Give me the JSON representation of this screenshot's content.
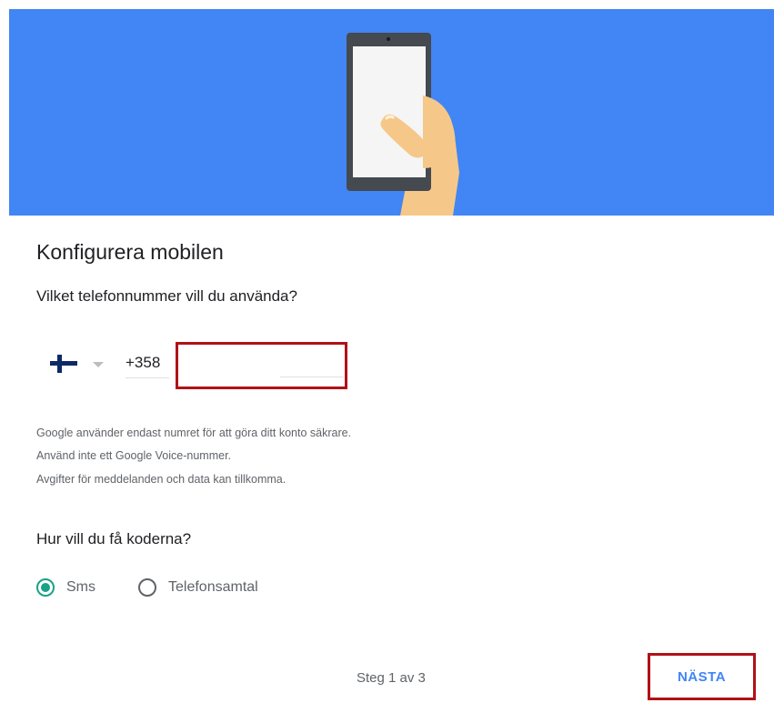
{
  "hero": {
    "illustration": "hand-holding-phone",
    "background_color": "#4285f4"
  },
  "page_title": "Konfigurera mobilen",
  "phone_section": {
    "question": "Vilket telefonnummer vill du använda?",
    "country_flag": "finland-flag-icon",
    "dropdown_icon": "chevron-down-icon",
    "country_code": "+358",
    "phone_value": "",
    "highlight_color": "#b11116"
  },
  "info_lines": [
    "Google använder endast numret för att göra ditt konto säkrare.",
    "Använd inte ett Google Voice-nummer.",
    "Avgifter för meddelanden och data kan tillkomma."
  ],
  "code_section": {
    "question": "Hur vill du få koderna?",
    "options": [
      {
        "label": "Sms",
        "selected": true
      },
      {
        "label": "Telefonsamtal",
        "selected": false
      }
    ],
    "accent_color": "#1aa187"
  },
  "footer": {
    "step_text": "Steg 1 av 3",
    "next_label": "NÄSTA",
    "next_color": "#4285f4"
  }
}
